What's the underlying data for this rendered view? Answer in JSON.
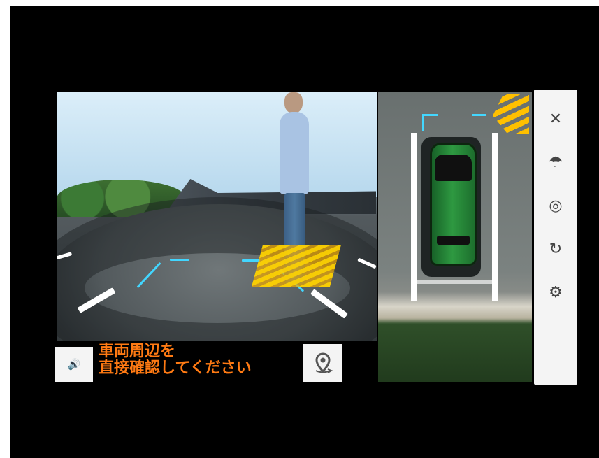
{
  "message": {
    "line1": "車両周辺を",
    "line2": "直接確認してください"
  },
  "icons": {
    "sound": "speaker-icon",
    "location": "location-pin-icon",
    "close": "close-icon",
    "view1": "front-view-icon",
    "view2": "side-view-icon",
    "view3": "rear-view-icon",
    "settings": "gear-icon"
  },
  "colors": {
    "warning_text": "#ff7a13",
    "guide_blue": "#42d6ff",
    "hatch_yellow": "#ffc000",
    "toolbar_bg": "#f4f4f4"
  }
}
